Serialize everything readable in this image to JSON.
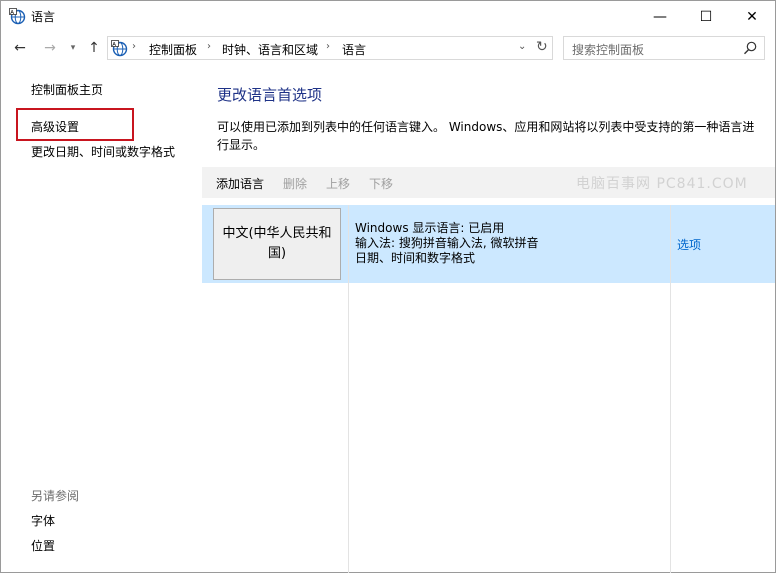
{
  "window": {
    "title": "语言",
    "controls": {
      "minimize": "—",
      "maximize": "☐",
      "close": "✕"
    }
  },
  "navbar": {
    "back": "←",
    "forward": "→",
    "recent": "▾",
    "up": "↑",
    "breadcrumb": [
      "控制面板",
      "时钟、语言和区域",
      "语言"
    ],
    "search_placeholder": "搜索控制面板"
  },
  "left_pane": {
    "links": [
      "控制面板主页",
      "高级设置",
      "更改日期、时间或数字格式"
    ],
    "see_also_title": "另请参阅",
    "see_also_links": [
      "字体",
      "位置"
    ]
  },
  "main": {
    "title": "更改语言首选项",
    "description": "可以使用已添加到列表中的任何语言键入。 Windows、应用和网站将以列表中受支持的第一种语言进行显示。",
    "toolbar": [
      "添加语言",
      "删除",
      "上移",
      "下移"
    ],
    "watermark": "电脑百事网 PC841.COM",
    "languages": [
      {
        "name": "中文(中华人民共和国)",
        "info": [
          "Windows 显示语言: 已启用",
          "输入法: 搜狗拼音输入法, 微软拼音",
          "日期、时间和数字格式"
        ],
        "options_label": "选项"
      }
    ]
  },
  "colors": {
    "title_blue": "#1e3287",
    "link_blue": "#0066cc",
    "selection": "#cce8ff",
    "highlight_red": "#c8151f"
  }
}
